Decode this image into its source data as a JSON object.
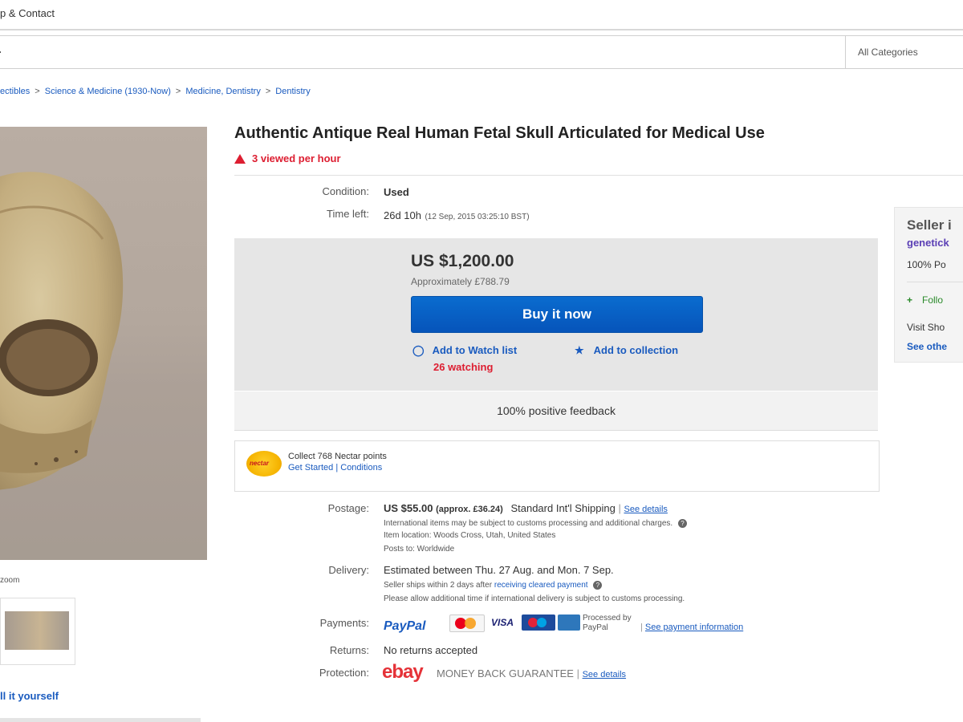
{
  "topbar": {
    "text": "p & Contact"
  },
  "search": {
    "category": "All Categories"
  },
  "breadcrumb": [
    "ectibles",
    "Science & Medicine (1930-Now)",
    "Medicine, Dentistry",
    "Dentistry"
  ],
  "gallery": {
    "zoom_text": "zoom",
    "sell_link": "ll it yourself"
  },
  "listing": {
    "title": "Authentic Antique Real Human Fetal Skull Articulated for Medical Use",
    "viewed": "3 viewed per hour",
    "condition_label": "Condition:",
    "condition_value": "Used",
    "time_left_label": "Time left:",
    "time_left_value": "26d 10h",
    "time_left_detail": "(12 Sep, 2015   03:25:10 BST)"
  },
  "buybox": {
    "price": "US $1,200.00",
    "approx": "Approximately £788.79",
    "buy_button": "Buy it now",
    "watch_label": "Add to Watch list",
    "collection_label": "Add to collection",
    "watching": "26 watching",
    "feedback": "100% positive feedback"
  },
  "nectar": {
    "logo_text": "nectar",
    "line1": "Collect 768 Nectar points",
    "get_started": "Get Started",
    "conditions": "Conditions"
  },
  "postage": {
    "label": "Postage:",
    "price": "US $55.00",
    "approx": "(approx. £36.24)",
    "method": "Standard Int'l Shipping",
    "see_details": "See details",
    "note": "International items may be subject to customs processing and additional charges.",
    "location": "Item location:  Woods Cross, Utah, United States",
    "posts_to": "Posts to:  Worldwide"
  },
  "delivery": {
    "label": "Delivery:",
    "estimate": "Estimated between Thu. 27 Aug. and Mon. 7 Sep.",
    "seller_note": "Seller ships within 2 days after",
    "seller_link": "receiving cleared payment",
    "allow_note": "Please allow additional time if international delivery is subject to customs processing."
  },
  "payments": {
    "label": "Payments:",
    "paypal": "PayPal",
    "visa": "VISA",
    "processed": "Processed by PayPal",
    "info_link": "See payment information"
  },
  "returns": {
    "label": "Returns:",
    "value": "No returns accepted"
  },
  "protection": {
    "label": "Protection:",
    "ebay": "ebay",
    "guarantee": "MONEY BACK GUARANTEE",
    "see_details": "See details"
  },
  "seller": {
    "heading": "Seller i",
    "name": "genetick",
    "positive": "100% Po",
    "follow": "Follo",
    "visit": "Visit Sho",
    "see_other": "See othe"
  }
}
